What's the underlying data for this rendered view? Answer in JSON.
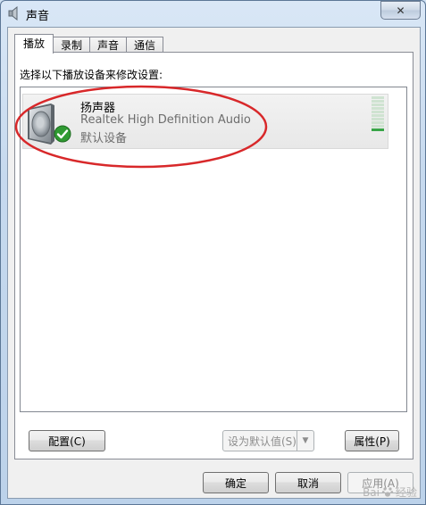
{
  "window": {
    "title": "声音",
    "close_glyph": "✕",
    "icons": [
      "speaker-icon",
      "close-icon"
    ]
  },
  "tabs": [
    {
      "label": "播放",
      "active": true
    },
    {
      "label": "录制",
      "active": false
    },
    {
      "label": "声音",
      "active": false
    },
    {
      "label": "通信",
      "active": false
    }
  ],
  "playback": {
    "instruction": "选择以下播放设备来修改设置:",
    "devices": [
      {
        "name": "扬声器",
        "driver": "Realtek High Definition Audio",
        "status": "默认设备",
        "icon": "speaker-icon",
        "badge": "green-check-icon",
        "level_fraction": 0.1
      }
    ],
    "configure_label": "配置(C)",
    "set_default_label": "设为默认值(S)",
    "properties_label": "属性(P)"
  },
  "dialog_buttons": {
    "ok": "确定",
    "cancel": "取消",
    "apply": "应用(A)"
  },
  "annotation": {
    "color": "#d8282a",
    "shape": "ellipse"
  },
  "watermark": {
    "brand": "Bai",
    "suffix": "经验"
  }
}
